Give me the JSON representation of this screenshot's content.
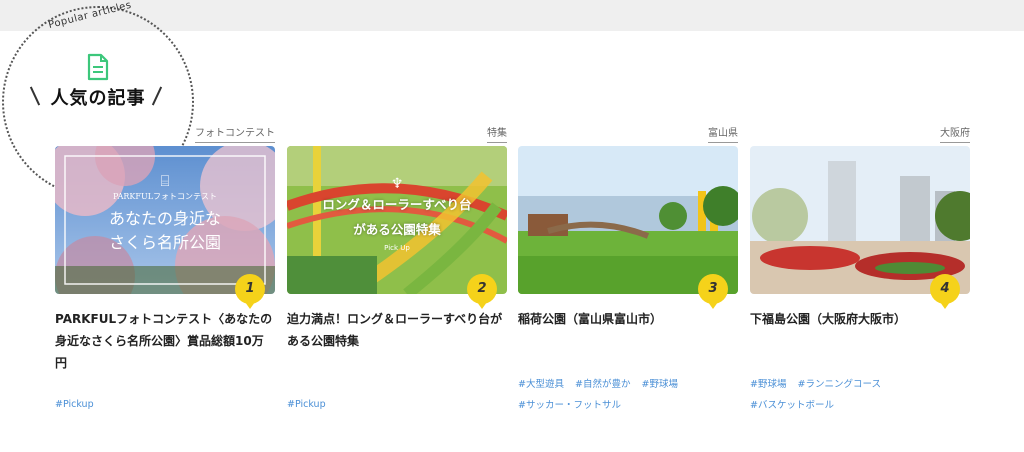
{
  "section": {
    "subtitle": "Popular articles",
    "title": "人気の記事",
    "icon": "document-icon",
    "accent_color": "#3cc77b"
  },
  "articles": [
    {
      "rank": "1",
      "category": "フォトコンテスト",
      "title": "PARKFULフォトコンテスト〈あなたの身近なさくら名所公園〉賞品総額10万円",
      "image_text": {
        "camera_icon": "camera-icon",
        "brand": "PARKFULフォトコンテスト",
        "line1": "あなたの身近な",
        "line2": "さくら名所公園"
      },
      "tags": [
        "#Pickup"
      ]
    },
    {
      "rank": "2",
      "category": "特集",
      "title": "迫力満点！ロング＆ローラーすべり台がある公園特集",
      "image_text": {
        "line1": "ロング＆ローラーすべり台",
        "line2": "がある公園特集",
        "pickup": "Pick Up"
      },
      "tags": [
        "#Pickup"
      ]
    },
    {
      "rank": "3",
      "category": "富山県",
      "title": "稲荷公園（富山県富山市）",
      "tags": [
        "#大型遊具",
        "#自然が豊か",
        "#野球場",
        "#サッカー・フットサル"
      ]
    },
    {
      "rank": "4",
      "category": "大阪府",
      "title": "下福島公園（大阪府大阪市）",
      "tags": [
        "#野球場",
        "#ランニングコース",
        "#バスケットボール"
      ]
    }
  ],
  "colors": {
    "rank_badge": "#f5d21a",
    "tag_text": "#4a8fd6"
  }
}
